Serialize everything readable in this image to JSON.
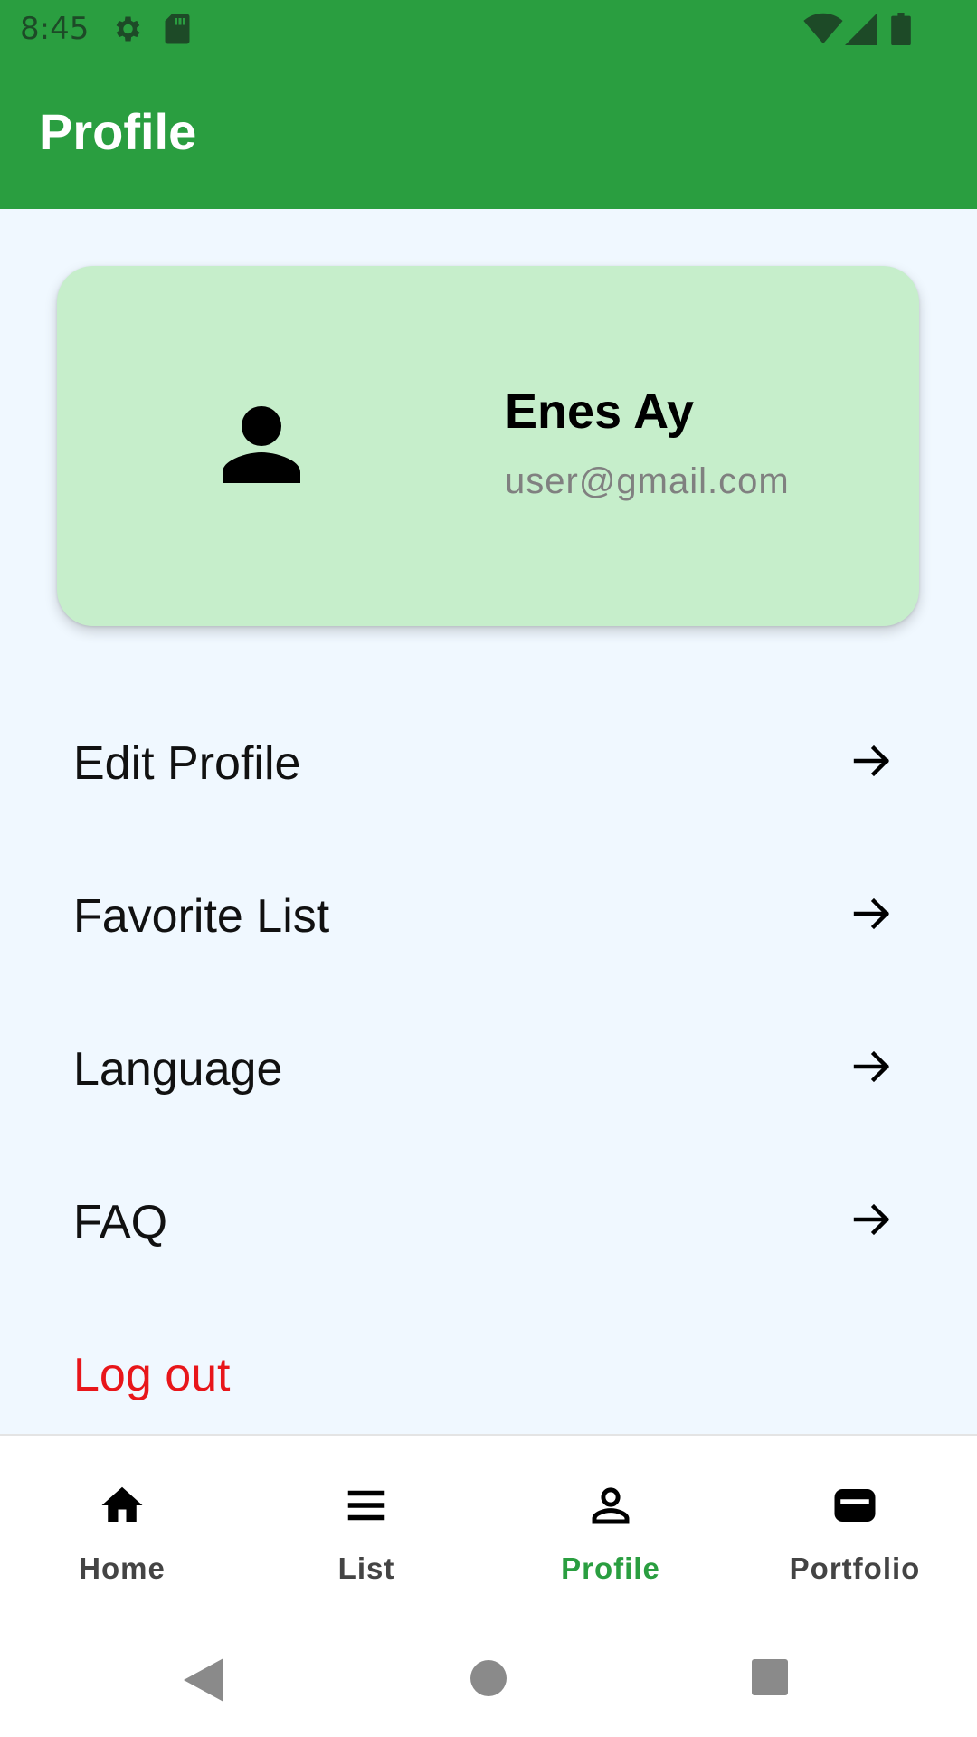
{
  "status_bar": {
    "time": "8:45"
  },
  "header": {
    "title": "Profile"
  },
  "profile": {
    "name": "Enes Ay",
    "email": "user@gmail.com"
  },
  "menu": {
    "items": [
      {
        "label": "Edit Profile"
      },
      {
        "label": "Favorite List"
      },
      {
        "label": "Language"
      },
      {
        "label": "FAQ"
      }
    ],
    "logout_label": "Log out"
  },
  "bottom_nav": {
    "items": [
      {
        "label": "Home",
        "icon": "home-icon"
      },
      {
        "label": "List",
        "icon": "list-icon"
      },
      {
        "label": "Profile",
        "icon": "person-outline-icon",
        "active": true
      },
      {
        "label": "Portfolio",
        "icon": "wallet-icon"
      }
    ]
  },
  "colors": {
    "primary": "#2A9E40",
    "card_bg": "#C6EECB",
    "page_bg": "#F0F8FF",
    "logout": "#E8161A",
    "email": "#808080"
  }
}
